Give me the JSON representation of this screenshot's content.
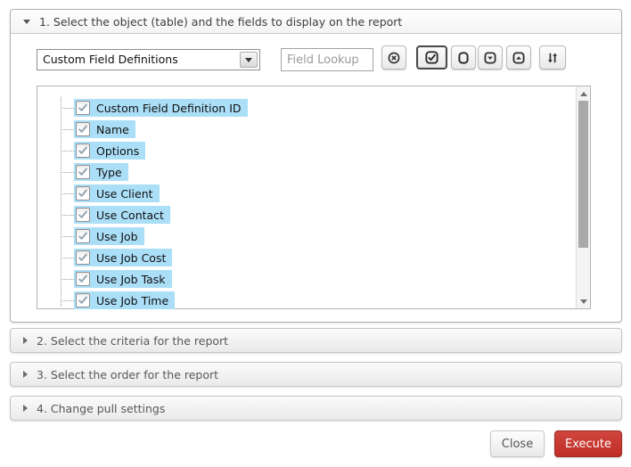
{
  "accordion": {
    "section1": {
      "title": "1. Select the object (table) and the fields to display on the report",
      "state": "expanded",
      "expanded_icon": "triangle-down",
      "object_select": {
        "value": "Custom Field Definitions",
        "arrow_icon": "triangle-down"
      },
      "field_lookup": {
        "placeholder": "Field Lookup",
        "value": ""
      },
      "toolbar": {
        "buttons": [
          {
            "name": "clear-selection",
            "icon": "circle-x",
            "pressed": false
          },
          {
            "name": "check-all",
            "icon": "boxed-checkmark",
            "pressed": true
          },
          {
            "name": "uncheck-all",
            "icon": "empty-box",
            "pressed": false
          },
          {
            "name": "collapse-all",
            "icon": "boxed-triangle-down",
            "pressed": false
          },
          {
            "name": "expand-all",
            "icon": "boxed-triangle-up",
            "pressed": false
          },
          {
            "name": "sort-fields",
            "icon": "down-up-arrows",
            "pressed": false
          }
        ]
      },
      "fields": [
        {
          "label": "Custom Field Definition ID",
          "checked": true,
          "highlighted": true
        },
        {
          "label": "Name",
          "checked": true,
          "highlighted": true
        },
        {
          "label": "Options",
          "checked": true,
          "highlighted": true
        },
        {
          "label": "Type",
          "checked": true,
          "highlighted": true
        },
        {
          "label": "Use Client",
          "checked": true,
          "highlighted": true
        },
        {
          "label": "Use Contact",
          "checked": true,
          "highlighted": true
        },
        {
          "label": "Use Job",
          "checked": true,
          "highlighted": true
        },
        {
          "label": "Use Job Cost",
          "checked": true,
          "highlighted": true
        },
        {
          "label": "Use Job Task",
          "checked": true,
          "highlighted": true
        },
        {
          "label": "Use Job Time",
          "checked": true,
          "highlighted": true
        }
      ],
      "scrollbar": {
        "up_icon": "triangle-up",
        "down_icon": "triangle-down",
        "thumb_visible": true
      }
    },
    "section2": {
      "title": "2. Select the criteria for the report",
      "state": "collapsed",
      "collapsed_icon": "triangle-right"
    },
    "section3": {
      "title": "3. Select the order for the report",
      "state": "collapsed",
      "collapsed_icon": "triangle-right"
    },
    "section4": {
      "title": "4. Change pull settings",
      "state": "collapsed",
      "collapsed_icon": "triangle-right"
    }
  },
  "footer": {
    "close_label": "Close",
    "execute_label": "Execute"
  },
  "colors": {
    "field_highlight": "#abdff8",
    "execute_red": "#c5332c",
    "panel_border": "#b1b1b1",
    "checkmark_gray": "#93a5b2"
  }
}
